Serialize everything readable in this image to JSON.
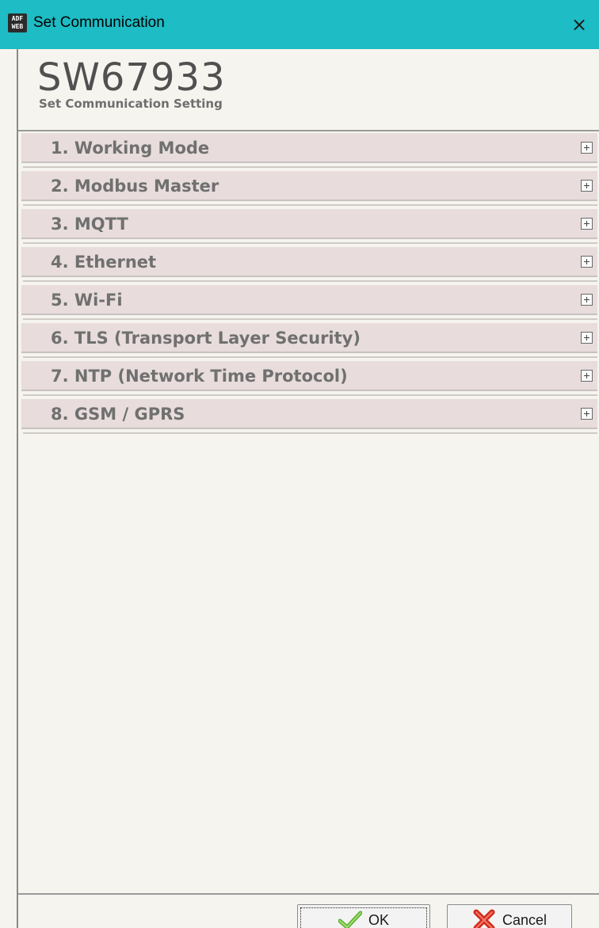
{
  "window": {
    "title": "Set Communication",
    "app_icon_text": [
      "ADF",
      "WEB"
    ],
    "close_glyph": "×",
    "titlebar_color": "#1ebcc4"
  },
  "header": {
    "product_code": "SW67933",
    "subtitle": "Set Communication Setting"
  },
  "sections": [
    {
      "label": "1. Working Mode",
      "icon": "expand-plus-icon"
    },
    {
      "label": "2. Modbus Master",
      "icon": "expand-plus-icon"
    },
    {
      "label": "3. MQTT",
      "icon": "expand-plus-icon"
    },
    {
      "label": "4. Ethernet",
      "icon": "expand-plus-icon"
    },
    {
      "label": "5. Wi-Fi",
      "icon": "expand-plus-icon"
    },
    {
      "label": "6. TLS (Transport Layer Security)",
      "icon": "expand-plus-icon"
    },
    {
      "label": "7. NTP (Network Time Protocol)",
      "icon": "expand-plus-icon"
    },
    {
      "label": "8. GSM / GPRS",
      "icon": "expand-plus-icon"
    }
  ],
  "buttons": {
    "ok_label": "OK",
    "ok_icon": "check-icon",
    "cancel_label": "Cancel",
    "cancel_icon": "red-x-icon"
  },
  "colors": {
    "section_bg": "#e8dcdc",
    "section_text": "#707070",
    "background": "#f6f4ee"
  }
}
